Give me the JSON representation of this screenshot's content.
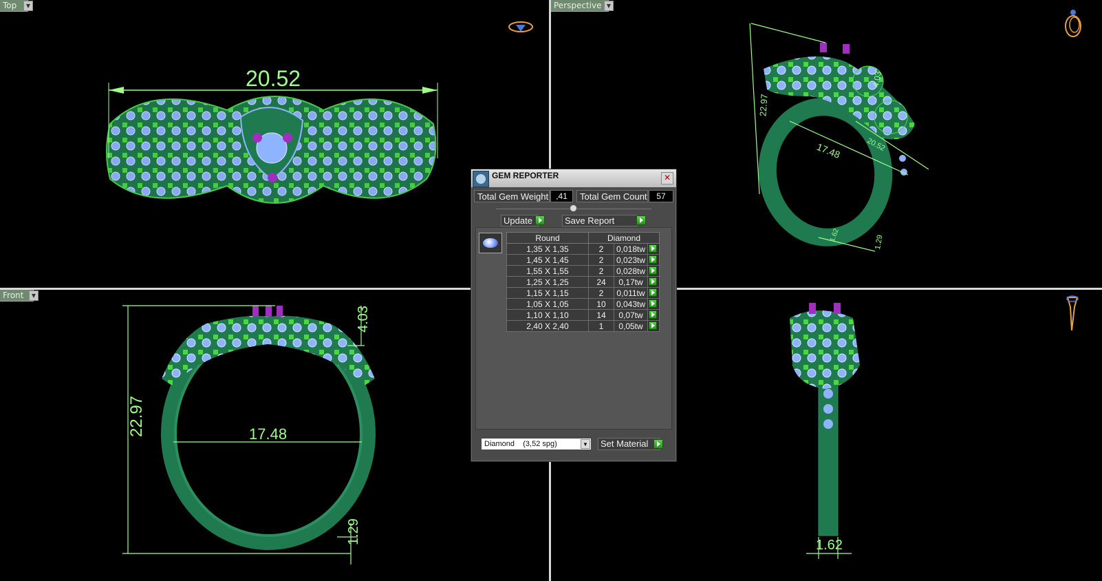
{
  "viewports": {
    "top": {
      "label": "Top"
    },
    "perspective": {
      "label": "Perspective"
    },
    "front": {
      "label": "Front"
    }
  },
  "dimensions": {
    "top_width": "20.52",
    "persp_height": "22.97",
    "persp_inner": "17.48",
    "persp_outer": "20.52",
    "persp_head": "4.03",
    "persp_shank": "1.29",
    "persp_base": "1.62",
    "front_height": "22.97",
    "front_inner": "17.48",
    "front_head": "4.03",
    "front_shank": "1.29",
    "side_base": "1.62"
  },
  "gem_reporter": {
    "title": "GEM REPORTER",
    "total_weight_label": "Total Gem Weight",
    "total_weight_value": ",41",
    "total_count_label": "Total Gem Count",
    "total_count_value": "57",
    "update_label": "Update",
    "save_report_label": "Save Report",
    "columns": [
      "Round",
      "Diamond"
    ],
    "rows": [
      {
        "size": "1,35 X 1,35",
        "count": "2",
        "weight": "0,018tw"
      },
      {
        "size": "1,45 X 1,45",
        "count": "2",
        "weight": "0,023tw"
      },
      {
        "size": "1,55 X 1,55",
        "count": "2",
        "weight": "0,028tw"
      },
      {
        "size": "1,25 X 1,25",
        "count": "24",
        "weight": "0,17tw"
      },
      {
        "size": "1,15 X 1,15",
        "count": "2",
        "weight": "0,011tw"
      },
      {
        "size": "1,05 X 1,05",
        "count": "10",
        "weight": "0,043tw"
      },
      {
        "size": "1,10 X 1,10",
        "count": "14",
        "weight": "0,07tw"
      },
      {
        "size": "2,40 X 2,40",
        "count": "1",
        "weight": "0,05tw"
      }
    ],
    "material_value": "Diamond    (3,52 spg)",
    "set_material_label": "Set Material"
  },
  "colors": {
    "metal": "#1f7a4f",
    "prong": "#4bd64a",
    "gem": "#8fb4ff",
    "accent_gem": "#a02fc0",
    "dimension": "#9fff8a"
  }
}
